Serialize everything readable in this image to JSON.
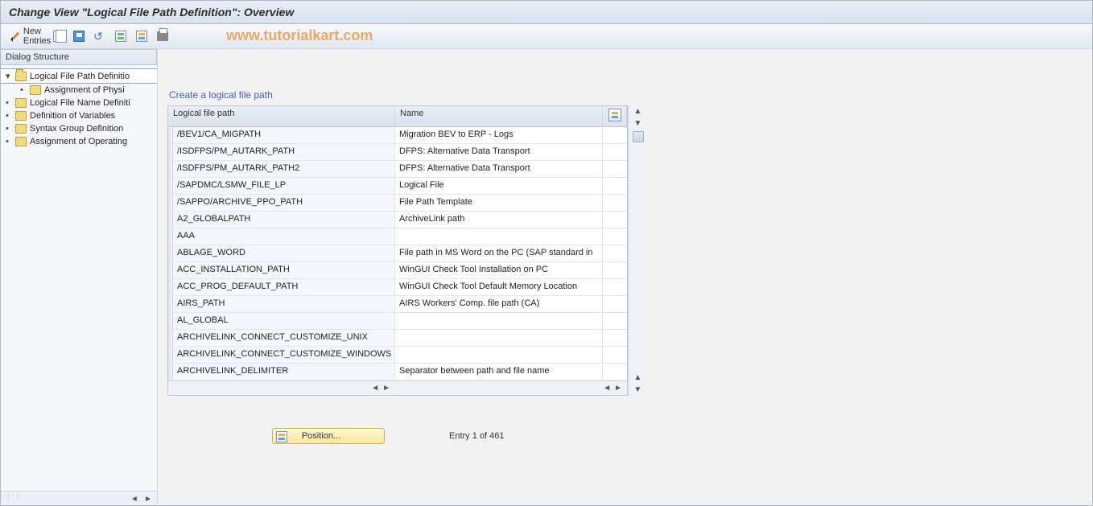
{
  "title": "Change View \"Logical File Path Definition\": Overview",
  "toolbar": {
    "new_entries_label": "New Entries"
  },
  "watermark": "www.tutorialkart.com",
  "sidebar": {
    "header": "Dialog Structure",
    "items": [
      {
        "label": "Logical File Path Definitio",
        "open": true,
        "level": 0,
        "selected": true
      },
      {
        "label": "Assignment of Physi",
        "open": false,
        "level": 1
      },
      {
        "label": "Logical File Name Definiti",
        "open": false,
        "level": 0
      },
      {
        "label": "Definition of Variables",
        "open": false,
        "level": 0
      },
      {
        "label": "Syntax Group Definition",
        "open": false,
        "level": 0
      },
      {
        "label": "Assignment of Operating",
        "open": false,
        "level": 0
      }
    ]
  },
  "panel": {
    "title": "Create a logical file path",
    "columns": {
      "path": "Logical file path",
      "name": "Name"
    },
    "rows": [
      {
        "path": "/BEV1/CA_MIGPATH",
        "name": "Migration BEV to ERP - Logs"
      },
      {
        "path": "/ISDFPS/PM_AUTARK_PATH",
        "name": "DFPS: Alternative Data Transport"
      },
      {
        "path": "/ISDFPS/PM_AUTARK_PATH2",
        "name": "DFPS: Alternative Data Transport"
      },
      {
        "path": "/SAPDMC/LSMW_FILE_LP",
        "name": "Logical File"
      },
      {
        "path": "/SAPPO/ARCHIVE_PPO_PATH",
        "name": "File Path Template"
      },
      {
        "path": "A2_GLOBALPATH",
        "name": "ArchiveLink path"
      },
      {
        "path": "AAA",
        "name": ""
      },
      {
        "path": "ABLAGE_WORD",
        "name": "File path in MS Word on the PC (SAP standard in"
      },
      {
        "path": "ACC_INSTALLATION_PATH",
        "name": "WinGUI Check Tool Installation on PC"
      },
      {
        "path": "ACC_PROG_DEFAULT_PATH",
        "name": "WinGUI Check Tool Default Memory Location"
      },
      {
        "path": "AIRS_PATH",
        "name": "AIRS Workers' Comp. file path (CA)"
      },
      {
        "path": "AL_GLOBAL",
        "name": ""
      },
      {
        "path": "ARCHIVELINK_CONNECT_CUSTOMIZE_UNIX",
        "name": ""
      },
      {
        "path": "ARCHIVELINK_CONNECT_CUSTOMIZE_WINDOWS",
        "name": ""
      },
      {
        "path": "ARCHIVELINK_DELIMITER",
        "name": "Separator between path and file name"
      }
    ]
  },
  "footer": {
    "position_label": "Position...",
    "entry_info": "Entry 1 of 461"
  }
}
